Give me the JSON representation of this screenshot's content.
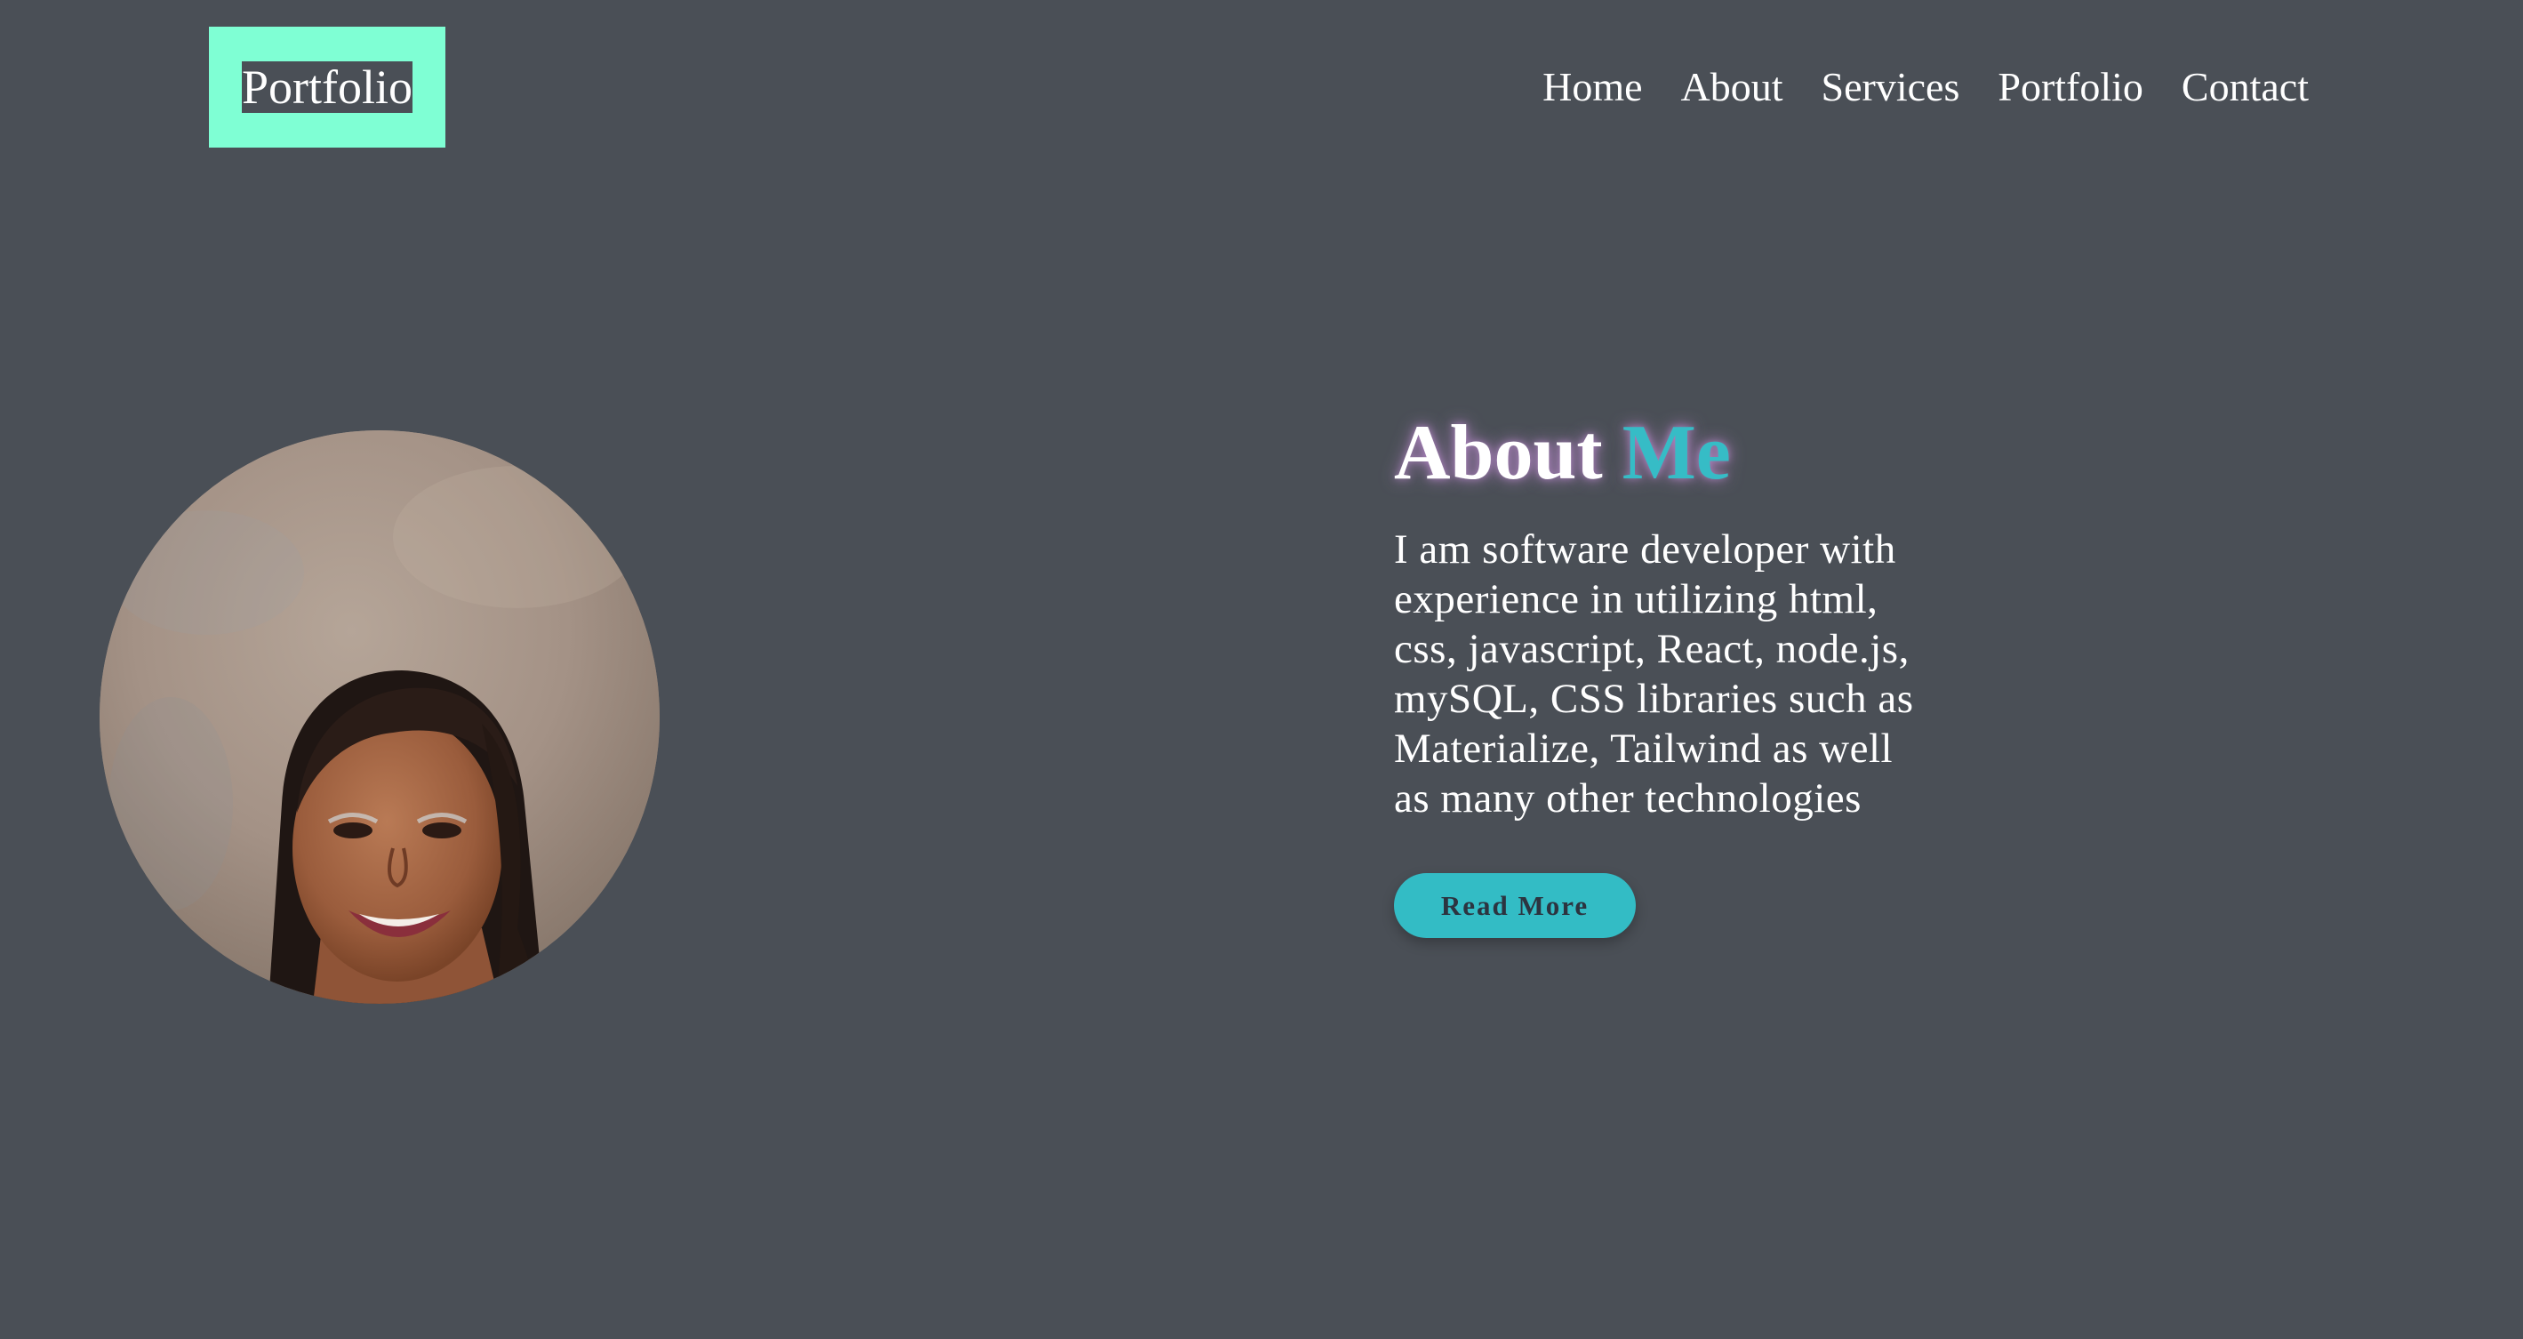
{
  "header": {
    "logo": "Portfolio",
    "nav": [
      "Home",
      "About",
      "Services",
      "Portfolio",
      "Contact"
    ]
  },
  "about": {
    "title_main": "About",
    "title_accent": "Me",
    "description": "I am software developer with experience in utilizing html, css, javascript, React, node.js, mySQL, CSS libraries such as Materialize, Tailwind as well as many other technologies",
    "button_label": "Read More"
  },
  "colors": {
    "background": "#4a4f56",
    "logo_box": "#7fffd4",
    "accent": "#36bcc6",
    "button": "#33bcc5",
    "title_glow": "#d296e6"
  },
  "images": {
    "profile_photo": "profile-photo"
  }
}
